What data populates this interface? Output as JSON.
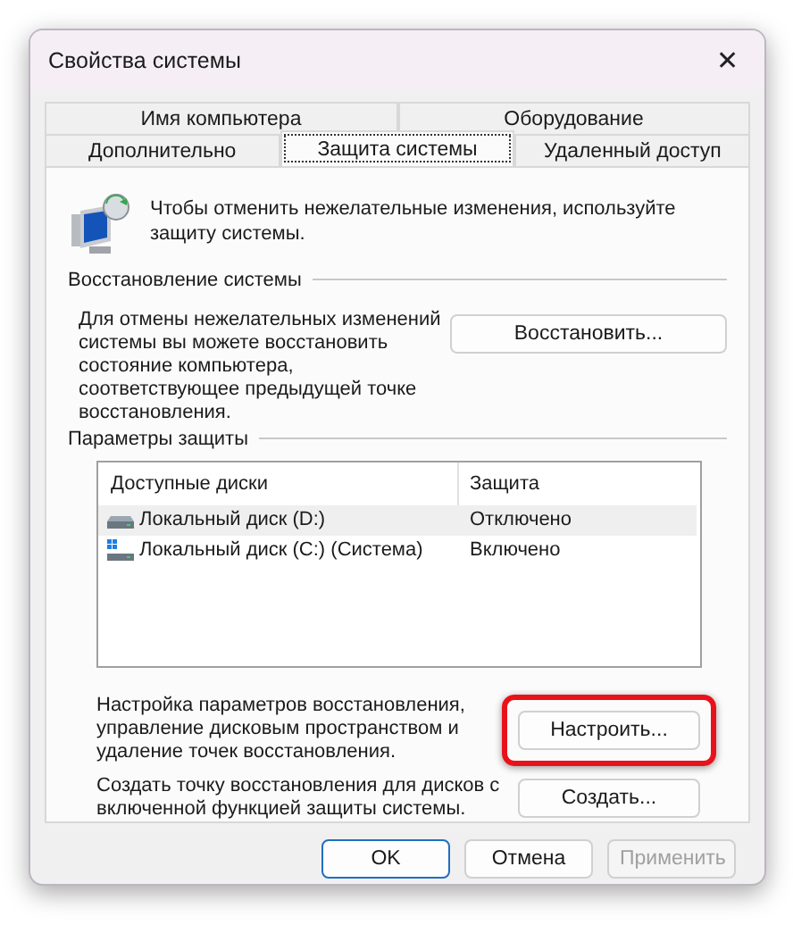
{
  "window": {
    "title": "Свойства системы",
    "close": "✕"
  },
  "tab_rows": [
    [
      {
        "label": "Имя компьютера",
        "selected": false
      },
      {
        "label": "Оборудование",
        "selected": false
      }
    ],
    [
      {
        "label": "Дополнительно",
        "selected": false
      },
      {
        "label": "Защита системы",
        "selected": true
      },
      {
        "label": "Удаленный доступ",
        "selected": false
      }
    ]
  ],
  "intro": "Чтобы отменить нежелательные изменения, используйте защиту системы.",
  "restore": {
    "heading": "Восстановление системы",
    "text": "Для отмены нежелательных изменений системы вы можете восстановить состояние компьютера, соответствующее предыдущей точке восстановления.",
    "button": {
      "label": "Восстановить...",
      "highlighted": false
    }
  },
  "protection": {
    "heading": "Параметры защиты",
    "columns": [
      "Доступные диски",
      "Защита"
    ],
    "rows": [
      {
        "kind": "drive",
        "name": "Локальный диск (D:)",
        "status": "Отключено",
        "selected": true
      },
      {
        "kind": "system",
        "name": "Локальный диск (C:) (Система)",
        "status": "Включено",
        "selected": false
      }
    ],
    "actions": [
      {
        "text": "Настройка параметров восстановления, управление дисковым пространством и удаление точек восстановления.",
        "button": {
          "label": "Настроить...",
          "highlighted": true
        }
      },
      {
        "text": "Создать точку восстановления для дисков с включенной функцией защиты системы.",
        "button": {
          "label": "Создать...",
          "highlighted": false
        }
      }
    ]
  },
  "buttons": [
    {
      "label": "OK",
      "kind": "default",
      "disabled": false
    },
    {
      "label": "Отмена",
      "kind": "normal",
      "disabled": false
    },
    {
      "label": "Применить",
      "kind": "normal",
      "disabled": true
    }
  ]
}
